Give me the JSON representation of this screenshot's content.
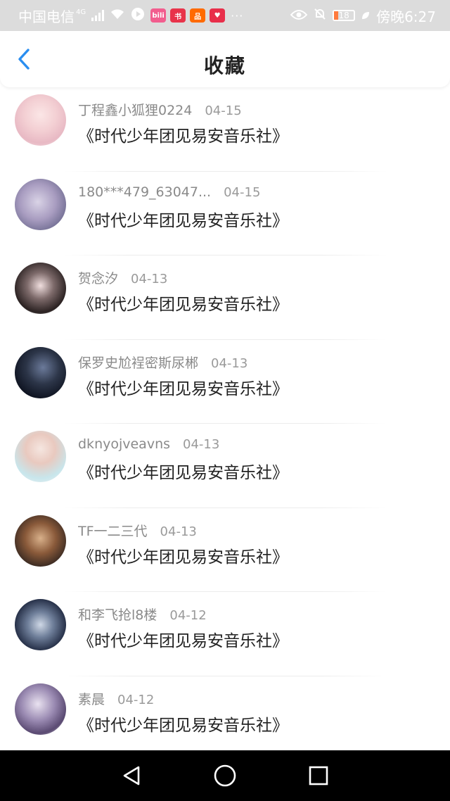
{
  "status_bar": {
    "carrier": "中国电信",
    "network": "4G",
    "battery_percent": "18",
    "time": "傍晚6:27",
    "dots": "···",
    "app_badges": [
      {
        "name": "bilibili-badge-icon",
        "color": "#f25d8e",
        "text": "bili"
      },
      {
        "name": "book-badge-icon",
        "color": "#e8334a",
        "text": "书"
      },
      {
        "name": "grid-badge-icon",
        "color": "#ff6a00",
        "text": "品"
      },
      {
        "name": "heart-badge-icon",
        "color": "#e82e4a",
        "text": "♥"
      }
    ]
  },
  "header": {
    "title": "收藏",
    "back_icon": "chevron-left-icon",
    "accent_color": "#2a8ef0"
  },
  "items": [
    {
      "username": "丁程鑫小狐狸0224",
      "date": "04-15",
      "title": "《时代少年团见易安音乐社》"
    },
    {
      "username": "180***479_63047...",
      "date": "04-15",
      "title": "《时代少年团见易安音乐社》"
    },
    {
      "username": "贺念汐",
      "date": "04-13",
      "title": "《时代少年团见易安音乐社》"
    },
    {
      "username": "保罗史尬裎密斯尿郴",
      "date": "04-13",
      "title": "《时代少年团见易安音乐社》"
    },
    {
      "username": "dknyojveavns",
      "date": "04-13",
      "title": "《时代少年团见易安音乐社》"
    },
    {
      "username": "TF一二三代",
      "date": "04-13",
      "title": "《时代少年团见易安音乐社》"
    },
    {
      "username": "和李飞抢l8楼",
      "date": "04-12",
      "title": "《时代少年团见易安音乐社》"
    },
    {
      "username": "素晨",
      "date": "04-12",
      "title": "《时代少年团见易安音乐社》"
    }
  ],
  "nav_bar": {
    "back_icon": "triangle-back-icon",
    "home_icon": "circle-home-icon",
    "recents_icon": "square-recents-icon"
  }
}
